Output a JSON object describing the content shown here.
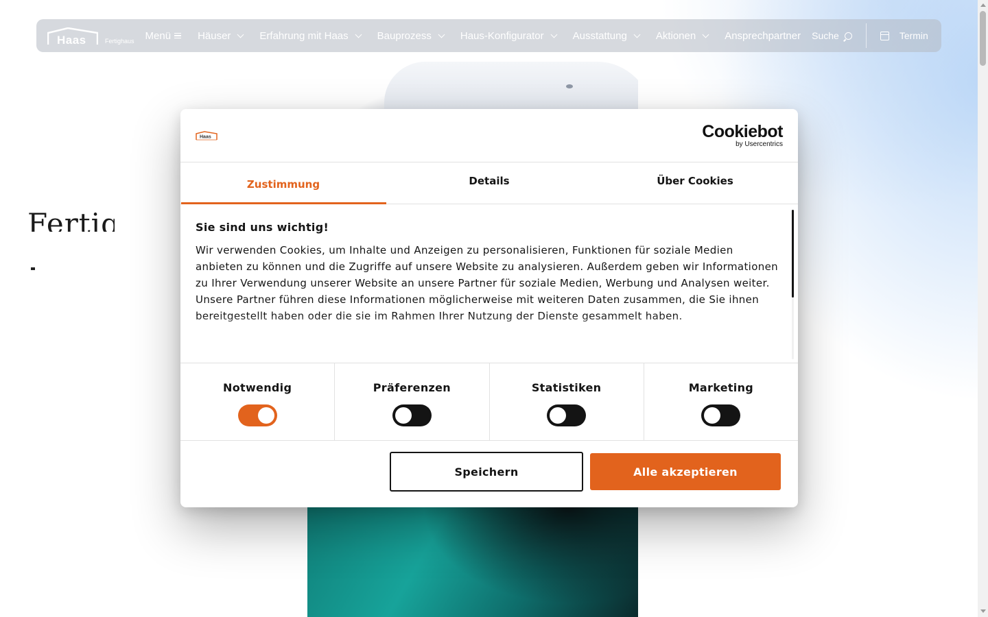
{
  "brand": {
    "logo_text": "Haas",
    "logo_sub": "Fertighaus",
    "accent": "#e2631d"
  },
  "nav": {
    "menu_label": "Menü",
    "items": [
      {
        "label": "Häuser"
      },
      {
        "label": "Erfahrung mit Haas"
      },
      {
        "label": "Bauprozess"
      },
      {
        "label": "Haus-Konfigurator"
      },
      {
        "label": "Ausstattung"
      },
      {
        "label": "Aktionen"
      }
    ],
    "contact_label": "Ansprechpartner",
    "search_label": "Suche",
    "appointment_label": "Termin"
  },
  "hero": {
    "partial_heading": "Fertig"
  },
  "cookie_dialog": {
    "provider_name": "Cookiebot",
    "provider_sub": "by Usercentrics",
    "mini_logo_text": "Haas",
    "tabs": [
      {
        "label": "Zustimmung",
        "active": true
      },
      {
        "label": "Details",
        "active": false
      },
      {
        "label": "Über Cookies",
        "active": false
      }
    ],
    "heading": "Sie sind uns wichtig!",
    "body": "Wir verwenden Cookies, um Inhalte und Anzeigen zu personalisieren, Funktionen für soziale Medien anbieten zu können und die Zugriffe auf unsere Website zu analysieren. Außerdem geben wir Informationen zu Ihrer Verwendung unserer Website an unsere Partner für soziale Medien, Werbung und Analysen weiter. Unsere Partner führen diese Informationen möglicherweise mit weiteren Daten zusammen, die Sie ihnen bereitgestellt haben oder die sie im Rahmen Ihrer Nutzung der Dienste gesammelt haben.",
    "categories": [
      {
        "label": "Notwendig",
        "on": true
      },
      {
        "label": "Präferenzen",
        "on": false
      },
      {
        "label": "Statistiken",
        "on": false
      },
      {
        "label": "Marketing",
        "on": false
      }
    ],
    "save_label": "Speichern",
    "accept_all_label": "Alle akzeptieren"
  }
}
